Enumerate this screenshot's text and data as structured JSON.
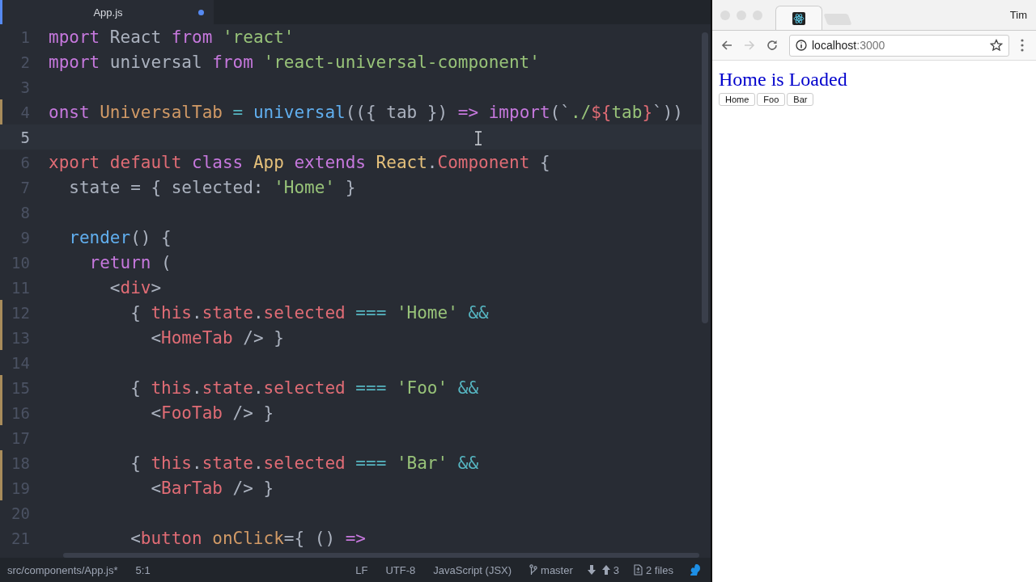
{
  "editor": {
    "tab": {
      "label": "App.js",
      "modified": true
    },
    "lines": [
      {
        "n": "1",
        "changed": false,
        "current": false,
        "tokens": [
          {
            "text": "mport",
            "kind": "keyword"
          },
          {
            "text": " React ",
            "kind": "plain"
          },
          {
            "text": "from",
            "kind": "keyword"
          },
          {
            "text": " 'react'",
            "kind": "string"
          }
        ]
      },
      {
        "n": "2",
        "changed": false,
        "current": false,
        "tokens": [
          {
            "text": "mport",
            "kind": "keyword"
          },
          {
            "text": " universal ",
            "kind": "plain"
          },
          {
            "text": "from",
            "kind": "keyword"
          },
          {
            "text": " 'react-universal-component'",
            "kind": "string"
          }
        ]
      },
      {
        "n": "3",
        "changed": false,
        "current": false
      },
      {
        "n": "4",
        "changed": true,
        "current": false,
        "tokens": [
          {
            "text": "onst",
            "kind": "keyword"
          },
          {
            "text": " UniversalTab",
            "kind": "constant"
          },
          {
            "text": " =",
            "kind": "operator"
          },
          {
            "text": " universal",
            "kind": "function"
          },
          {
            "text": "(({ tab }) ",
            "kind": "plain"
          },
          {
            "text": "=>",
            "kind": "keyword"
          },
          {
            "text": " import",
            "kind": "keyword"
          },
          {
            "text": "(`",
            "kind": "plain"
          },
          {
            "text": "./",
            "kind": "string"
          },
          {
            "text": "${",
            "kind": "variable"
          },
          {
            "text": "tab",
            "kind": "string"
          },
          {
            "text": "}",
            "kind": "variable"
          },
          {
            "text": "`))",
            "kind": "plain"
          }
        ]
      },
      {
        "n": "5",
        "changed": false,
        "current": true
      },
      {
        "n": "6",
        "changed": false,
        "current": false,
        "tokens": [
          {
            "text": "xport default",
            "kind": "variable"
          },
          {
            "text": " class",
            "kind": "keyword"
          },
          {
            "text": " App",
            "kind": "class"
          },
          {
            "text": " extends",
            "kind": "keyword"
          },
          {
            "text": " React",
            "kind": "class"
          },
          {
            "text": ".",
            "kind": "plain"
          },
          {
            "text": "Component",
            "kind": "variable"
          },
          {
            "text": " {",
            "kind": "plain"
          }
        ]
      },
      {
        "n": "7",
        "changed": false,
        "current": false,
        "tokens": [
          {
            "text": "  state = { selected: ",
            "kind": "plain"
          },
          {
            "text": "'Home'",
            "kind": "string"
          },
          {
            "text": " }",
            "kind": "plain"
          }
        ]
      },
      {
        "n": "8",
        "changed": false,
        "current": false
      },
      {
        "n": "9",
        "changed": false,
        "current": false,
        "tokens": [
          {
            "text": "  render",
            "kind": "function"
          },
          {
            "text": "() {",
            "kind": "plain"
          }
        ]
      },
      {
        "n": "10",
        "changed": false,
        "current": false,
        "tokens": [
          {
            "text": "    return",
            "kind": "keyword"
          },
          {
            "text": " (",
            "kind": "plain"
          }
        ]
      },
      {
        "n": "11",
        "changed": false,
        "current": false,
        "tokens": [
          {
            "text": "      <",
            "kind": "plain"
          },
          {
            "text": "div",
            "kind": "variable"
          },
          {
            "text": ">",
            "kind": "plain"
          }
        ]
      },
      {
        "n": "12",
        "changed": true,
        "current": false,
        "tokens": [
          {
            "text": "        { ",
            "kind": "plain"
          },
          {
            "text": "this",
            "kind": "variable"
          },
          {
            "text": ".",
            "kind": "plain"
          },
          {
            "text": "state",
            "kind": "variable"
          },
          {
            "text": ".",
            "kind": "plain"
          },
          {
            "text": "selected",
            "kind": "variable"
          },
          {
            "text": " ===",
            "kind": "operator"
          },
          {
            "text": " 'Home'",
            "kind": "string"
          },
          {
            "text": " &&",
            "kind": "operator"
          }
        ]
      },
      {
        "n": "13",
        "changed": true,
        "current": false,
        "tokens": [
          {
            "text": "          <",
            "kind": "plain"
          },
          {
            "text": "HomeTab",
            "kind": "variable"
          },
          {
            "text": " /> }",
            "kind": "plain"
          }
        ]
      },
      {
        "n": "14",
        "changed": false,
        "current": false
      },
      {
        "n": "15",
        "changed": true,
        "current": false,
        "tokens": [
          {
            "text": "        { ",
            "kind": "plain"
          },
          {
            "text": "this",
            "kind": "variable"
          },
          {
            "text": ".",
            "kind": "plain"
          },
          {
            "text": "state",
            "kind": "variable"
          },
          {
            "text": ".",
            "kind": "plain"
          },
          {
            "text": "selected",
            "kind": "variable"
          },
          {
            "text": " ===",
            "kind": "operator"
          },
          {
            "text": " 'Foo'",
            "kind": "string"
          },
          {
            "text": " &&",
            "kind": "operator"
          }
        ]
      },
      {
        "n": "16",
        "changed": true,
        "current": false,
        "tokens": [
          {
            "text": "          <",
            "kind": "plain"
          },
          {
            "text": "FooTab",
            "kind": "variable"
          },
          {
            "text": " /> }",
            "kind": "plain"
          }
        ]
      },
      {
        "n": "17",
        "changed": false,
        "current": false
      },
      {
        "n": "18",
        "changed": true,
        "current": false,
        "tokens": [
          {
            "text": "        { ",
            "kind": "plain"
          },
          {
            "text": "this",
            "kind": "variable"
          },
          {
            "text": ".",
            "kind": "plain"
          },
          {
            "text": "state",
            "kind": "variable"
          },
          {
            "text": ".",
            "kind": "plain"
          },
          {
            "text": "selected",
            "kind": "variable"
          },
          {
            "text": " ===",
            "kind": "operator"
          },
          {
            "text": " 'Bar'",
            "kind": "string"
          },
          {
            "text": " &&",
            "kind": "operator"
          }
        ]
      },
      {
        "n": "19",
        "changed": true,
        "current": false,
        "tokens": [
          {
            "text": "          <",
            "kind": "plain"
          },
          {
            "text": "BarTab",
            "kind": "variable"
          },
          {
            "text": " /> }",
            "kind": "plain"
          }
        ]
      },
      {
        "n": "20",
        "changed": false,
        "current": false
      },
      {
        "n": "21",
        "changed": false,
        "current": false,
        "tokens": [
          {
            "text": "        <",
            "kind": "plain"
          },
          {
            "text": "button",
            "kind": "variable"
          },
          {
            "text": " onClick",
            "kind": "constant"
          },
          {
            "text": "={ () ",
            "kind": "plain"
          },
          {
            "text": "=>",
            "kind": "keyword"
          }
        ]
      }
    ]
  },
  "status_bar": {
    "path": "src/components/App.js*",
    "cursor": "5:1",
    "line_ending": "LF",
    "encoding": "UTF-8",
    "grammar": "JavaScript (JSX)",
    "branch": "master",
    "ahead": "3",
    "changes": "2 files"
  },
  "browser": {
    "user": "Tim",
    "url_host": "localhost",
    "url_port": ":3000",
    "heading": "Home is Loaded",
    "buttons": [
      "Home",
      "Foo",
      "Bar"
    ]
  }
}
